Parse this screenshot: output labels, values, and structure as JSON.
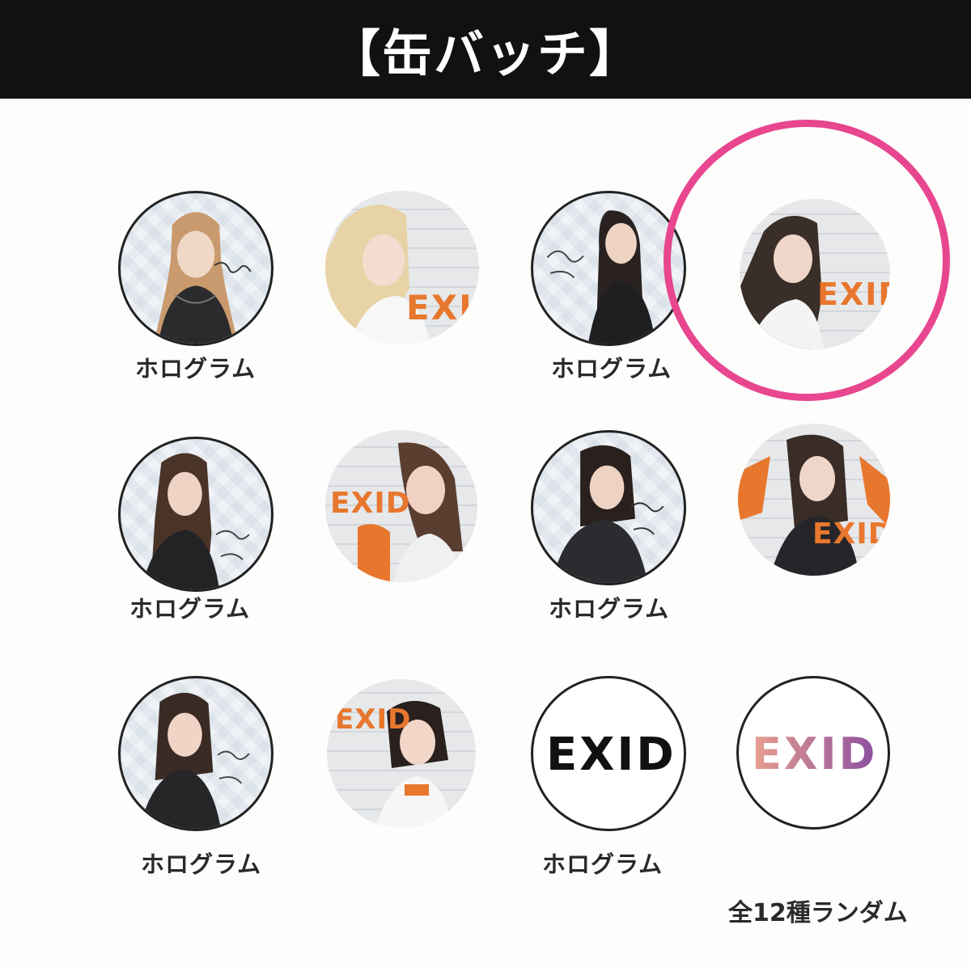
{
  "header": {
    "title": "【缶バッチ】"
  },
  "badges": [
    {
      "caption": "ホログラム"
    },
    {
      "logo": "EXID"
    },
    {
      "caption": "ホログラム"
    },
    {
      "logo": "EXID",
      "highlighted": true
    },
    {
      "caption": "ホログラム"
    },
    {
      "logo": "EXID"
    },
    {
      "caption": "ホログラム"
    },
    {
      "logo": "EXID"
    },
    {
      "caption": "ホログラム"
    },
    {
      "logo": "EXID"
    },
    {
      "caption": "ホログラム",
      "logo": "EXID"
    },
    {
      "logo": "EXID"
    }
  ],
  "footnote": "全12種ランダム",
  "colors": {
    "header_bg": "#111111",
    "highlight": "#e8468f",
    "logo_orange": "#e8772e",
    "logo_black": "#111111",
    "logo_gradient_start": "#e8a08f",
    "logo_gradient_end": "#8c4ea0"
  }
}
